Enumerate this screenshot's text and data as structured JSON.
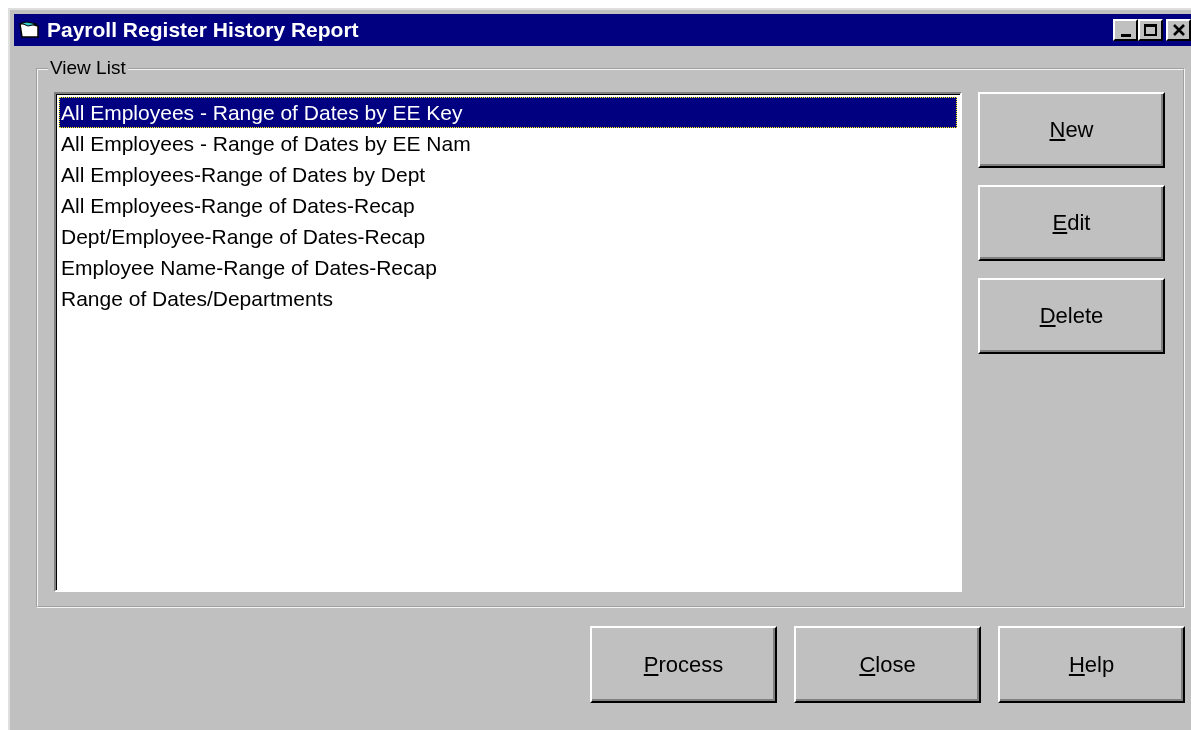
{
  "window": {
    "title": "Payroll Register History Report"
  },
  "view_list": {
    "label": "View List",
    "items": [
      {
        "label": "All Employees - Range of Dates by EE Key",
        "selected": true
      },
      {
        "label": "All Employees - Range of Dates by EE Nam",
        "selected": false
      },
      {
        "label": "All Employees-Range of Dates by Dept",
        "selected": false
      },
      {
        "label": "All Employees-Range of Dates-Recap",
        "selected": false
      },
      {
        "label": "Dept/Employee-Range of Dates-Recap",
        "selected": false
      },
      {
        "label": "Employee Name-Range of Dates-Recap",
        "selected": false
      },
      {
        "label": "Range of Dates/Departments",
        "selected": false
      }
    ]
  },
  "side_buttons": [
    {
      "label": "New",
      "underline_first": true
    },
    {
      "label": "Edit",
      "underline_first": true
    },
    {
      "label": "Delete",
      "underline_first": true
    }
  ],
  "bottom_buttons": [
    {
      "label": "Process",
      "underline_first": true
    },
    {
      "label": "Close",
      "underline_first": true
    },
    {
      "label": "Help",
      "underline_first": true
    }
  ]
}
